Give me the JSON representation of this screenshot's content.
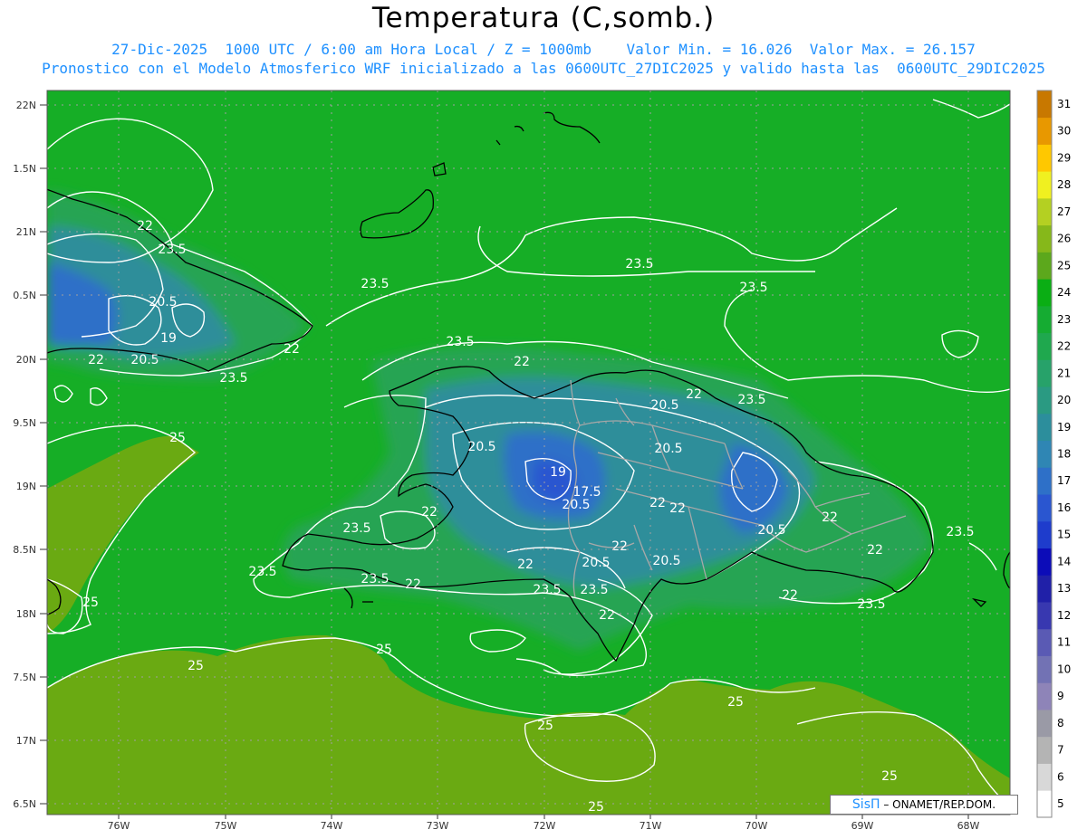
{
  "title": "Temperatura (C,somb.)",
  "subtitle1": "27-Dic-2025  1000 UTC / 6:00 am Hora Local / Z = 1000mb    Valor Min. = 16.026  Valor Max. = 26.157",
  "subtitle2": "Pronostico con el Modelo Atmosferico WRF inicializado a las 0600UTC_27DIC2025 y valido hasta las  0600UTC_29DIC2025",
  "credit": {
    "brand": "SisΠ",
    "text": "– ONAMET/REP.DOM."
  },
  "lat_labels": [
    "22N",
    "1.5N",
    "21N",
    "0.5N",
    "20N",
    "9.5N",
    "19N",
    "8.5N",
    "18N",
    "7.5N",
    "17N",
    "6.5N"
  ],
  "lon_labels": [
    "76W",
    "75W",
    "74W",
    "73W",
    "72W",
    "71W",
    "70W",
    "69W",
    "68W"
  ],
  "contour_labels": [
    "22",
    "23.5",
    "20.5",
    "19",
    "22",
    "20.5",
    "23.5",
    "23.5",
    "23.5",
    "23.5",
    "23.5",
    "22",
    "22",
    "20.5",
    "22",
    "23.5",
    "25",
    "20.5",
    "20.5",
    "19",
    "17.5",
    "20.5",
    "22",
    "22",
    "22",
    "23.5",
    "20.5",
    "22",
    "22",
    "23.5",
    "23.5",
    "23.5",
    "22",
    "22",
    "20.5",
    "20.5",
    "22",
    "23.5",
    "23.5",
    "22",
    "23.5",
    "25",
    "25",
    "25",
    "25",
    "25",
    "25",
    "25"
  ],
  "colorbar": {
    "labels": [
      "5",
      "6",
      "7",
      "8",
      "9",
      "10",
      "11",
      "12",
      "13",
      "14",
      "15",
      "16",
      "17",
      "18",
      "19",
      "20",
      "21",
      "22",
      "23",
      "24",
      "25",
      "26",
      "27",
      "28",
      "29",
      "30",
      "31"
    ],
    "colors": [
      "#ffffff",
      "#d8d8d8",
      "#b4b4b4",
      "#9a9aa6",
      "#8e84b8",
      "#7272b4",
      "#5a5ab4",
      "#3838b0",
      "#2020a8",
      "#0c0cb8",
      "#1e3ccc",
      "#2a56d0",
      "#2e70c8",
      "#2f86b4",
      "#2c8e9c",
      "#2a9a82",
      "#27a26a",
      "#1fa84e",
      "#15ac32",
      "#0aae14",
      "#5ca81c",
      "#86b81a",
      "#b4d022",
      "#f0f020",
      "#ffc800",
      "#e89800",
      "#c87800"
    ]
  },
  "field_colors": {
    "sea_warm": "#6aaa12",
    "sea": "#16ae26",
    "mid": "#26a452",
    "cool": "#2e8e9a",
    "cold": "#2e70c8",
    "colder": "#2a56d0"
  },
  "border_colors": {
    "coast": "#000000",
    "provinces": "#a8a8a8",
    "contours": "#ffffff"
  }
}
